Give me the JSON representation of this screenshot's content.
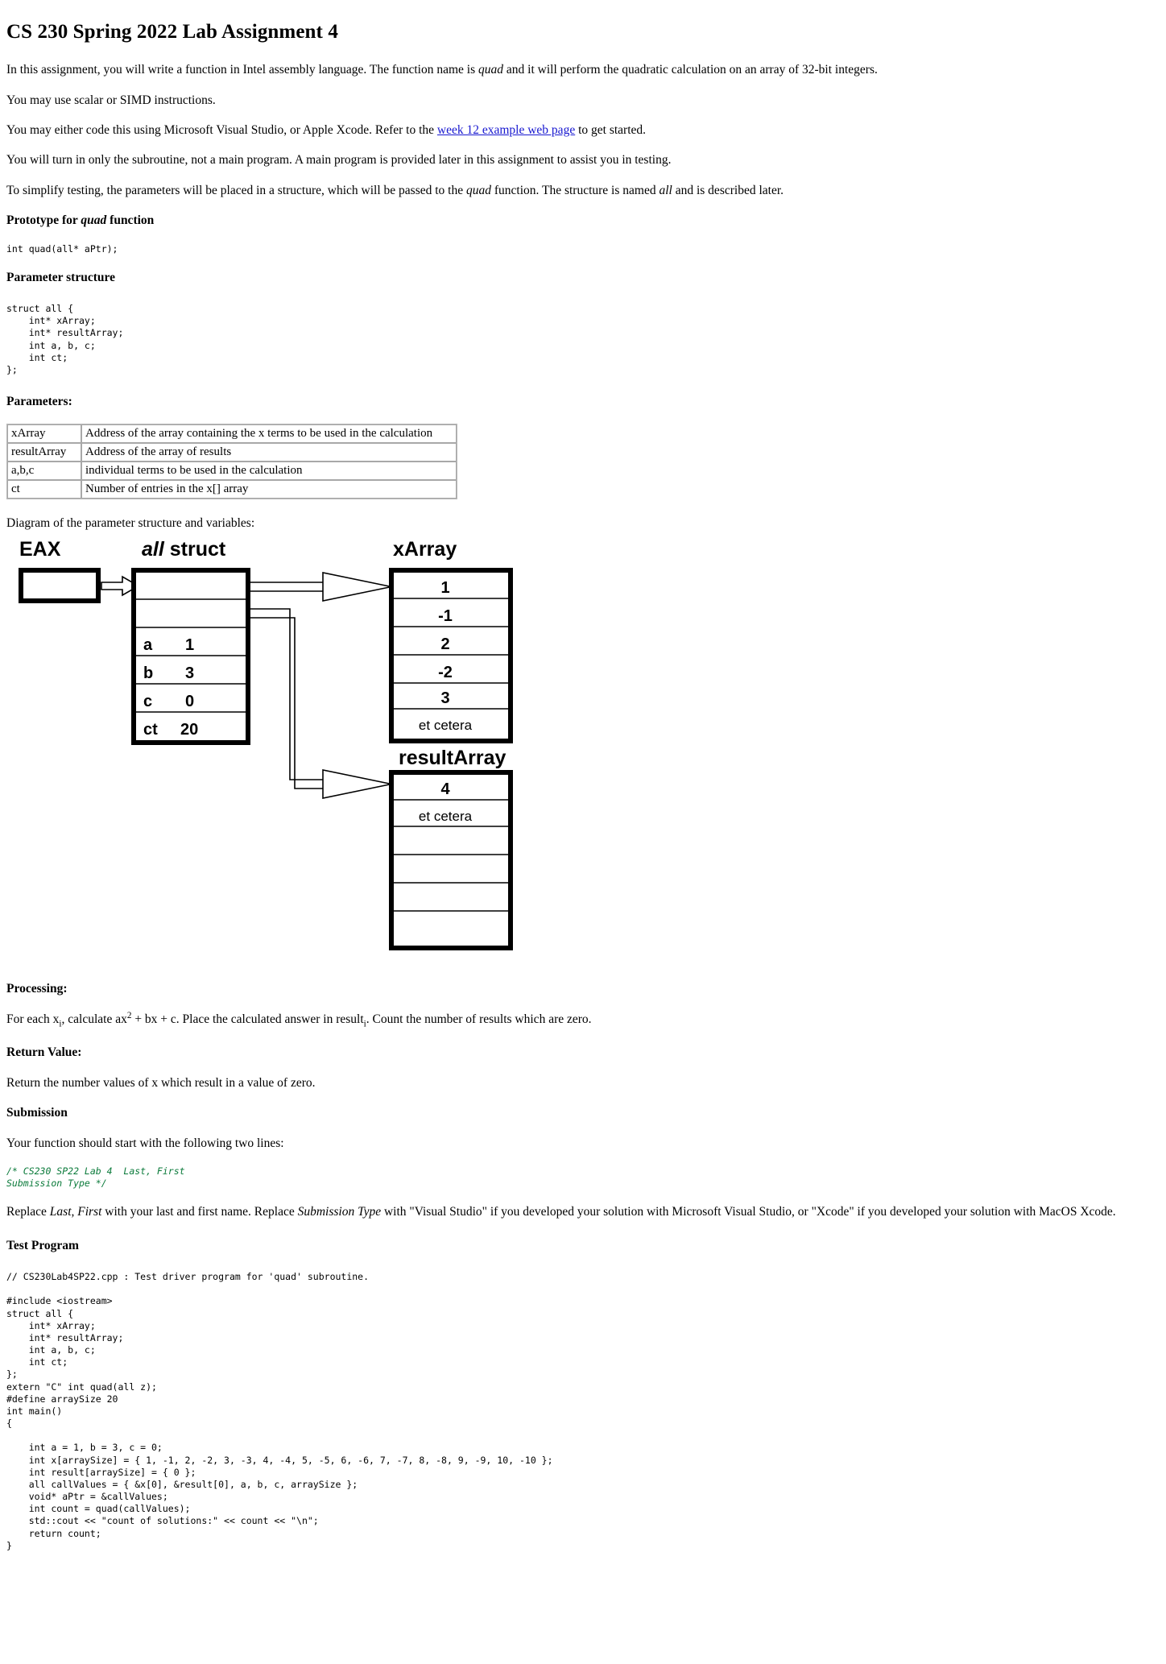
{
  "title": "CS 230 Spring 2022 Lab Assignment 4",
  "intro": {
    "p1_a": "In this assignment, you will write a function in Intel assembly language. The function name is ",
    "p1_fn": "quad",
    "p1_b": " and it will perform the quadratic calculation on an array of 32-bit integers.",
    "p2": "You may use scalar or SIMD instructions.",
    "p3_a": "You may either code this using Microsoft Visual Studio, or Apple Xcode. Refer to the ",
    "p3_link": "week 12 example web page",
    "p3_b": " to get started.",
    "p4": "You will turn in only the subroutine, not a main program. A main program is provided later in this assignment to assist you in testing.",
    "p5_a": "To simplify testing, the parameters will be placed in a structure, which will be passed to the ",
    "p5_fn": "quad",
    "p5_b": " function. The structure is named ",
    "p5_struct": "all",
    "p5_c": " and is described later."
  },
  "prototype": {
    "heading_a": "Prototype for ",
    "heading_fn": "quad",
    "heading_b": " function",
    "code": "int quad(all* aPtr);"
  },
  "parameter_structure": {
    "heading": "Parameter structure",
    "code": "struct all {\n    int* xArray;\n    int* resultArray;\n    int a, b, c;\n    int ct;\n};"
  },
  "parameters": {
    "heading": "Parameters:",
    "rows": [
      {
        "key": "xArray",
        "desc": "Address of the array containing the x terms to be used in the calculation"
      },
      {
        "key": "resultArray",
        "desc": "Address of the array of results"
      },
      {
        "key": "a,b,c",
        "desc": "individual terms to be used in the calculation"
      },
      {
        "key": "ct",
        "desc": "Number of entries in the x[] array"
      }
    ]
  },
  "diagram": {
    "caption": "Diagram of the parameter structure and variables:",
    "eax_label": "EAX",
    "struct_label_italic": "all",
    "struct_label_rest": " struct",
    "xarray_label": "xArray",
    "resultarray_label": "resultArray",
    "struct_fields": [
      {
        "name": "",
        "value": ""
      },
      {
        "name": "",
        "value": ""
      },
      {
        "name": "a",
        "value": "1"
      },
      {
        "name": "b",
        "value": "3"
      },
      {
        "name": "c",
        "value": "0"
      },
      {
        "name": "ct",
        "value": "20"
      }
    ],
    "xarray_cells": [
      "1",
      "-1",
      "2",
      "-2",
      "3",
      "et cetera"
    ],
    "resultarray_cells": [
      "4",
      "et cetera",
      "",
      "",
      "",
      "",
      ""
    ]
  },
  "processing": {
    "heading": "Processing:",
    "text_a": "For each x",
    "text_sub1": "i",
    "text_b": ", calculate ax",
    "text_sup": "2",
    "text_c": " + bx + c. Place the calculated answer in result",
    "text_sub2": "i",
    "text_d": ". Count the number of results which are zero."
  },
  "return_value": {
    "heading": "Return Value:",
    "text": "Return the number values of x which result in a value of zero."
  },
  "submission": {
    "heading": "Submission",
    "text": "Your function should start with the following two lines:",
    "code": "/* CS230 SP22 Lab 4  Last, First\nSubmission Type */",
    "after_a": "Replace ",
    "after_it1": "Last, First",
    "after_b": " with your last and first name. Replace ",
    "after_it2": "Submission Type",
    "after_c": " with \"Visual Studio\" if you developed your solution with Microsoft Visual Studio, or \"Xcode\" if you developed your solution with MacOS Xcode."
  },
  "test_program": {
    "heading": "Test Program",
    "code": "// CS230Lab4SP22.cpp : Test driver program for 'quad' subroutine.\n\n#include <iostream>\nstruct all {\n    int* xArray;\n    int* resultArray;\n    int a, b, c;\n    int ct;\n};\nextern \"C\" int quad(all z);\n#define arraySize 20\nint main()\n{\n\n    int a = 1, b = 3, c = 0;\n    int x[arraySize] = { 1, -1, 2, -2, 3, -3, 4, -4, 5, -5, 6, -6, 7, -7, 8, -8, 9, -9, 10, -10 };\n    int result[arraySize] = { 0 };\n    all callValues = { &x[0], &result[0], a, b, c, arraySize };\n    void* aPtr = &callValues;\n    int count = quad(callValues);\n    std::cout << \"count of solutions:\" << count << \"\\n\";\n    return count;\n}"
  },
  "colors": {
    "link": "#1818d0",
    "comment": "#0a7a3a"
  }
}
